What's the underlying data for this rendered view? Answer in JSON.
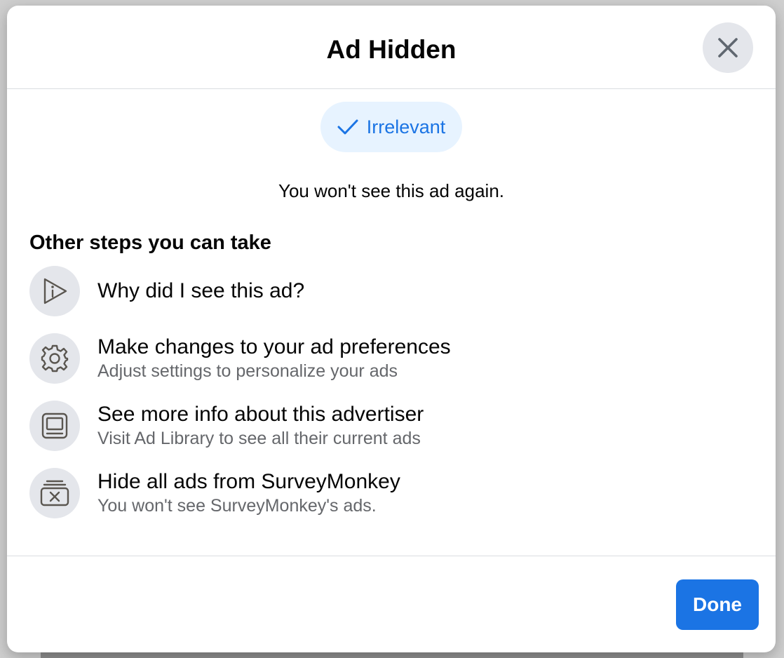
{
  "dialog": {
    "title": "Ad Hidden",
    "close_icon": "close-icon"
  },
  "reason_chip": {
    "label": "Irrelevant",
    "icon": "checkmark-icon",
    "color": "#1b74e4",
    "background": "#e7f3ff"
  },
  "notice": "You won't see this ad again.",
  "steps": {
    "heading": "Other steps you can take",
    "items": [
      {
        "title": "Why did I see this ad?",
        "subtitle": "",
        "icon": "ad-info-icon"
      },
      {
        "title": "Make changes to your ad preferences",
        "subtitle": "Adjust settings to personalize your ads",
        "icon": "gear-icon"
      },
      {
        "title": "See more info about this advertiser",
        "subtitle": "Visit Ad Library to see all their current ads",
        "icon": "ad-library-icon"
      },
      {
        "title": "Hide all ads from SurveyMonkey",
        "subtitle": "You won't see SurveyMonkey's ads.",
        "icon": "hide-ads-icon"
      }
    ]
  },
  "footer": {
    "done_label": "Done",
    "primary_color": "#1b74e4"
  }
}
